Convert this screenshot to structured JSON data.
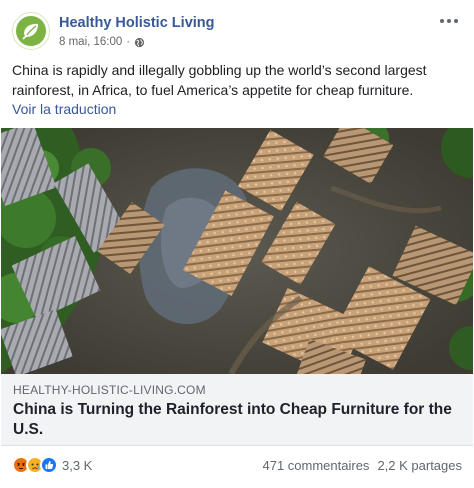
{
  "header": {
    "page_name": "Healthy Holistic Living",
    "timestamp": "8 mai, 16:00",
    "separator": "·",
    "privacy_icon": "globe-icon",
    "more_icon": "more-options-icon"
  },
  "post": {
    "text": "China is rapidly and illegally gobbling up the world’s second largest rainforest, in Africa, to fuel America’s appetite for cheap furniture.",
    "translate_label": "Voir la traduction"
  },
  "link_preview": {
    "image_alt": "aerial-photo-logging-site",
    "domain": "HEALTHY-HOLISTIC-LIVING.COM",
    "title": "China is Turning the Rainforest into Cheap Furniture for the U.S."
  },
  "footer": {
    "reaction_icons": [
      "angry-reaction-icon",
      "sad-reaction-icon",
      "like-reaction-icon"
    ],
    "reaction_count": "3,3 K",
    "comments": "471 commentaires",
    "shares": "2,2 K partages"
  },
  "colors": {
    "brand_link": "#385898",
    "avatar_green": "#7cb342",
    "link_box_bg": "#f2f3f5"
  }
}
